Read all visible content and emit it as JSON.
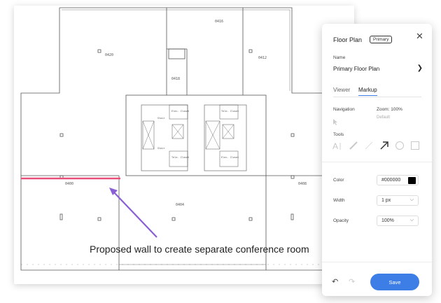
{
  "plan": {
    "rooms": [
      "0416",
      "0420",
      "0412",
      "0418",
      "0400",
      "0408",
      "0404"
    ],
    "closets": [
      "Stair",
      "Elec. Closet",
      "Tele. Closet",
      "Stair",
      "Tele. Closet",
      "Elec. Closet"
    ],
    "annotation": "Proposed wall to create separate conference room",
    "markup_color": "#e8507a",
    "arrow_color": "#8a5fd6"
  },
  "panel": {
    "title": "Floor Plan",
    "badge": "Primary",
    "name_label": "Name",
    "name_value": "Primary Floor Plan",
    "tabs": [
      "Viewer",
      "Markup"
    ],
    "navigation_label": "Navigation",
    "zoom_label": "Zoom: 100%",
    "default_label": "Default",
    "tools_label": "Tools",
    "tools": [
      "text-tool-icon",
      "pen-tool-icon",
      "line-tool-icon",
      "arrow-tool-icon",
      "circle-tool-icon",
      "rectangle-tool-icon"
    ],
    "color_label": "Color",
    "color_value": "#000000",
    "width_label": "Width",
    "width_value": "1 px",
    "opacity_label": "Opacity",
    "opacity_value": "100%",
    "save_label": "Save",
    "accent": "#3d7ee6"
  }
}
